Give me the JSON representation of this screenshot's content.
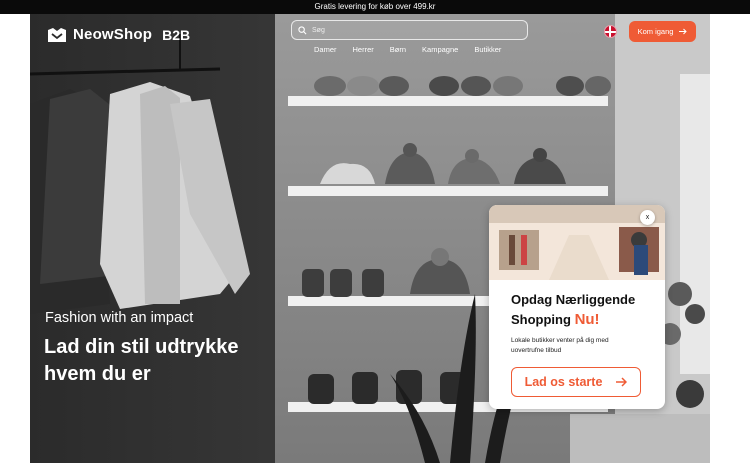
{
  "announcement": {
    "text": "Gratis levering for køb over 499.kr"
  },
  "header": {
    "brand": "NeowShop",
    "brand_suffix": "B2B",
    "search_placeholder": "Søg",
    "nav": [
      "Damer",
      "Herrer",
      "Børn",
      "Kampagne",
      "Butikker"
    ],
    "language_flag": "denmark-flag-icon",
    "cta_label": "Kom igang",
    "cta_icon": "arrow-right-icon"
  },
  "hero": {
    "tagline": "Fashion with an impact",
    "headline": "Lad din stil udtrykke hvem du er"
  },
  "popup": {
    "close_label": "x",
    "title_main": "Opdag Nærliggende Shopping",
    "title_accent": "Nu!",
    "body": "Lokale butikker venter på dig med uovertrufne tilbud",
    "button_label": "Lad os starte",
    "button_icon": "arrow-right-icon"
  },
  "colors": {
    "accent": "#ef5b35",
    "topbar": "#0a0a0a",
    "text_dark": "#111111"
  }
}
